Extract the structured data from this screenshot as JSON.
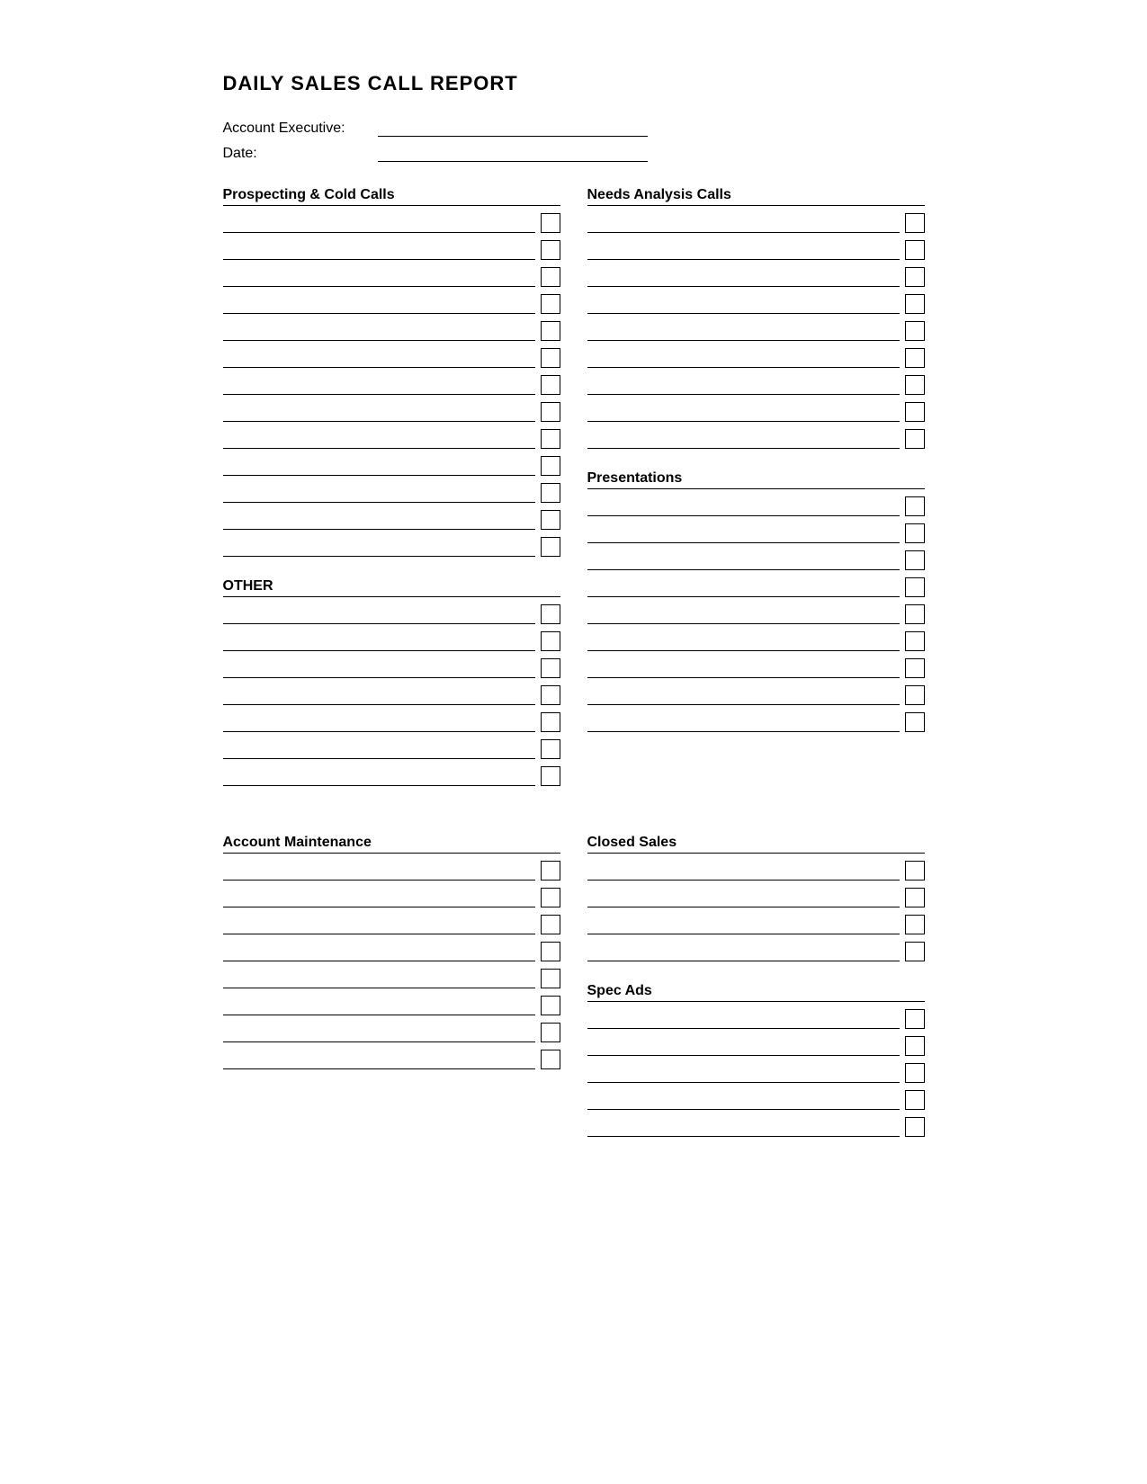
{
  "title": "DAILY SALES CALL REPORT",
  "header": {
    "account_executive_label": "Account Executive:",
    "date_label": "Date:"
  },
  "sections": {
    "prospecting": {
      "title": "Prospecting & Cold Calls",
      "rows": 13
    },
    "other": {
      "title": "OTHER",
      "rows": 7
    },
    "needs_analysis": {
      "title": "Needs Analysis Calls",
      "rows": 9
    },
    "presentations": {
      "title": "Presentations",
      "rows": 9
    },
    "account_maintenance": {
      "title": "Account Maintenance",
      "rows": 8
    },
    "closed_sales": {
      "title": "Closed Sales",
      "rows": 4
    },
    "spec_ads": {
      "title": "Spec Ads",
      "rows": 5
    }
  }
}
